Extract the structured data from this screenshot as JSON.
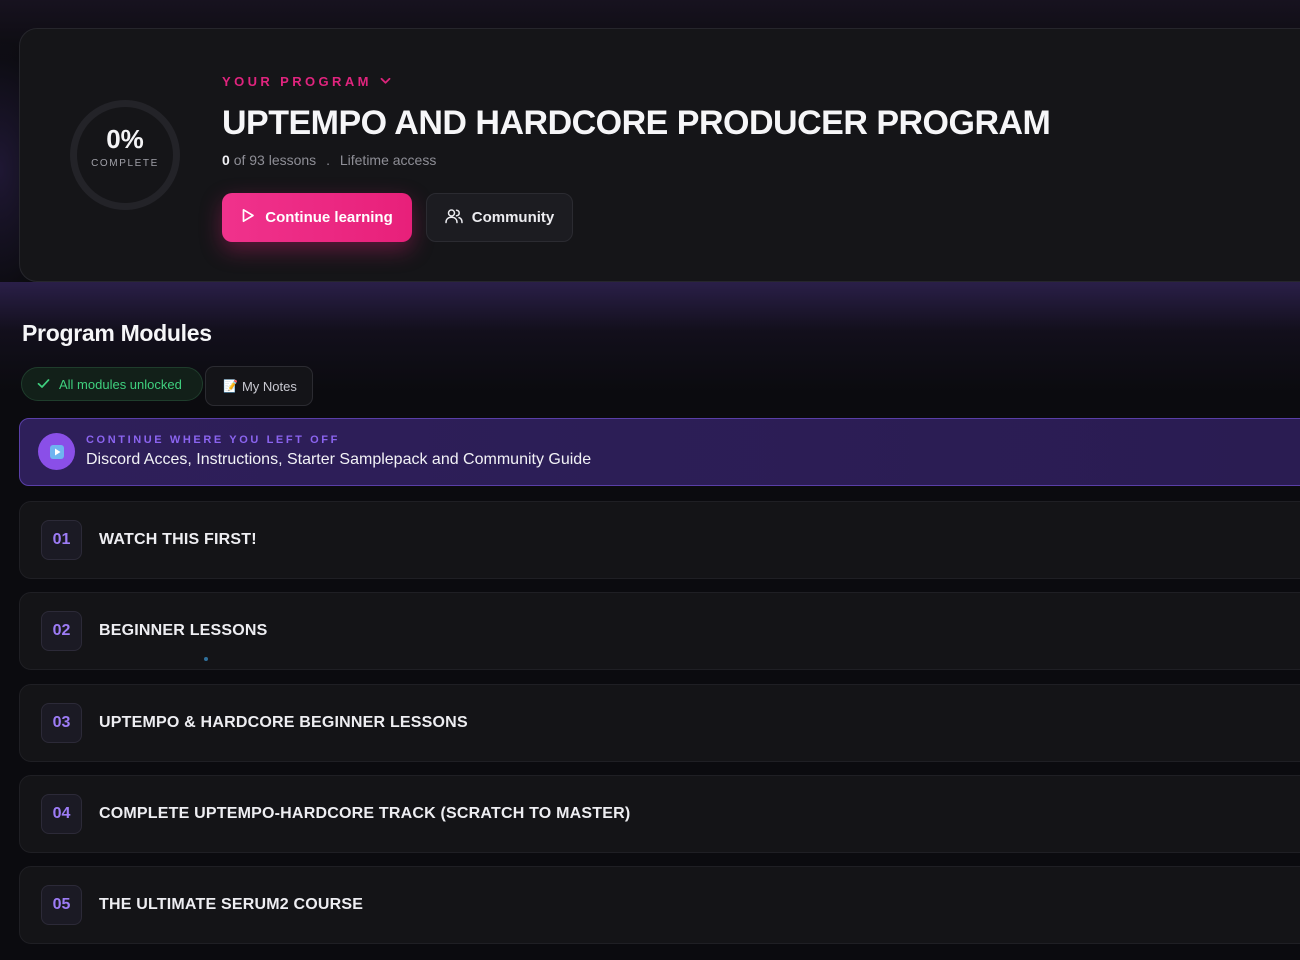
{
  "hero": {
    "progress_percent": "0%",
    "progress_label": "COMPLETE",
    "eyebrow": "YOUR PROGRAM",
    "title": "UPTEMPO AND HARDCORE PRODUCER PROGRAM",
    "lessons_done": "0",
    "lessons_total_text": "of 93 lessons",
    "separator": ".",
    "access": "Lifetime access",
    "continue_label": "Continue learning",
    "community_label": "Community"
  },
  "modules_section": {
    "title": "Program Modules",
    "unlocked_label": "All modules unlocked",
    "notes_emoji": "📝",
    "notes_label": "My Notes"
  },
  "resume": {
    "eyebrow": "CONTINUE WHERE YOU LEFT OFF",
    "title": "Discord Acces, Instructions, Starter Samplepack and Community Guide"
  },
  "modules": [
    {
      "number": "01",
      "title": "WATCH THIS FIRST!"
    },
    {
      "number": "02",
      "title": "BEGINNER LESSONS"
    },
    {
      "number": "03",
      "title": "UPTEMPO & HARDCORE BEGINNER LESSONS"
    },
    {
      "number": "04",
      "title": "COMPLETE UPTEMPO-HARDCORE TRACK (SCRATCH TO MASTER)"
    },
    {
      "number": "05",
      "title": "THE ULTIMATE SERUM2 COURSE"
    }
  ],
  "colors": {
    "accent_pink": "#e8207a",
    "accent_purple": "#8a4fe8",
    "success_green": "#3fd07e",
    "background": "#0b0b0f"
  },
  "icons": {
    "eyebrow": "chevron-down-icon",
    "continue": "play-icon",
    "community": "users-icon",
    "unlocked": "check-icon",
    "notes": "memo-icon",
    "resume": "play-icon"
  }
}
